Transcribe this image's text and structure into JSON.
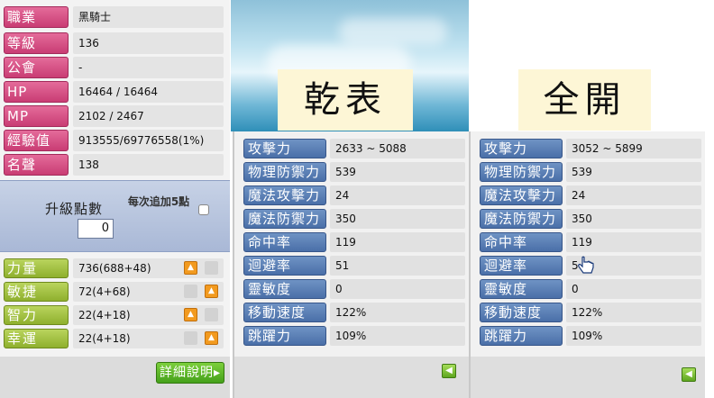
{
  "character_info": [
    {
      "label": "職業",
      "value": "黑騎士"
    },
    {
      "label": "等級",
      "value": "136"
    },
    {
      "label": "公會",
      "value": "-"
    },
    {
      "label": "HP",
      "value": "16464 / 16464"
    },
    {
      "label": "MP",
      "value": "2102 / 2467"
    },
    {
      "label": "經驗值",
      "value": "913555/69776558(1%)"
    },
    {
      "label": "名聲",
      "value": "138"
    }
  ],
  "ability_points": {
    "title": "升級點數",
    "value": "0",
    "each_add_label": "每次追加5點"
  },
  "stats": [
    {
      "label": "力量",
      "value": "736(688+48)"
    },
    {
      "label": "敏捷",
      "value": "72(4+68)"
    },
    {
      "label": "智力",
      "value": "22(4+18)"
    },
    {
      "label": "幸運",
      "value": "22(4+18)"
    }
  ],
  "detail_button": "詳細說明",
  "panel_mid": {
    "title": "乾表",
    "rows": [
      {
        "label": "攻擊力",
        "value": "2633 ~ 5088"
      },
      {
        "label": "物理防禦力",
        "value": "539"
      },
      {
        "label": "魔法攻擊力",
        "value": "24"
      },
      {
        "label": "魔法防禦力",
        "value": "350"
      },
      {
        "label": "命中率",
        "value": "119"
      },
      {
        "label": "迴避率",
        "value": "51"
      },
      {
        "label": "靈敏度",
        "value": "0"
      },
      {
        "label": "移動速度",
        "value": "122%"
      },
      {
        "label": "跳躍力",
        "value": "109%"
      }
    ]
  },
  "panel_right": {
    "title": "全開",
    "rows": [
      {
        "label": "攻擊力",
        "value": "3052 ~ 5899"
      },
      {
        "label": "物理防禦力",
        "value": "539"
      },
      {
        "label": "魔法攻擊力",
        "value": "24"
      },
      {
        "label": "魔法防禦力",
        "value": "350"
      },
      {
        "label": "命中率",
        "value": "119"
      },
      {
        "label": "迴避率",
        "value": "5"
      },
      {
        "label": "靈敏度",
        "value": "0"
      },
      {
        "label": "移動速度",
        "value": "122%"
      },
      {
        "label": "跳躍力",
        "value": "109%"
      }
    ]
  },
  "colors": {
    "info_label": "#c93d74",
    "stat_label": "#8fb02e",
    "detail_label": "#4a6fa8",
    "up_button": "#f29a1f"
  }
}
